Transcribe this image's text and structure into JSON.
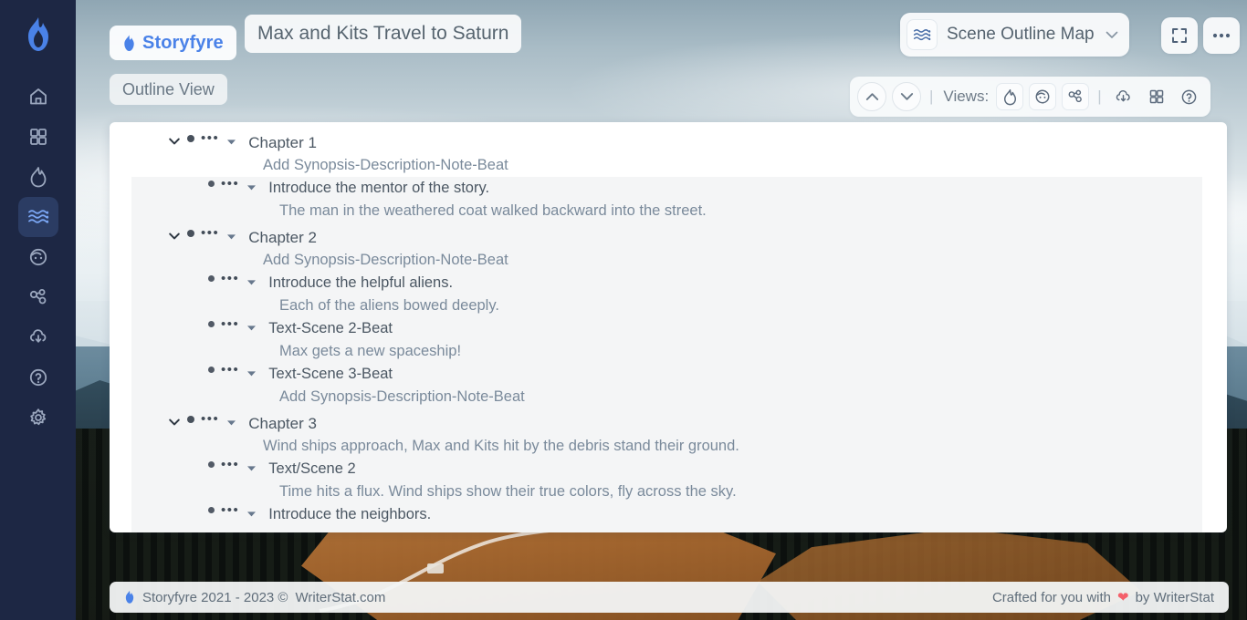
{
  "brand": {
    "name": "Storyfyre",
    "logo_icon": "flame-icon",
    "accent_color": "#4a82e8"
  },
  "document": {
    "title": "Max and Kits Travel to Saturn",
    "view_mode": "Outline View"
  },
  "sidebar": {
    "items": [
      {
        "icon": "home-icon",
        "name": "home"
      },
      {
        "icon": "grid-icon",
        "name": "dashboard"
      },
      {
        "icon": "flame-icon",
        "name": "story"
      },
      {
        "icon": "waves-icon",
        "name": "scene-outline-map",
        "active": true
      },
      {
        "icon": "face-icon",
        "name": "characters"
      },
      {
        "icon": "molecule-icon",
        "name": "relations"
      },
      {
        "icon": "cloud-download-icon",
        "name": "export"
      },
      {
        "icon": "help-circle-icon",
        "name": "help"
      },
      {
        "icon": "gear-icon",
        "name": "settings"
      }
    ]
  },
  "toolbar": {
    "map_select_label": "Scene Outline Map",
    "map_select_icon": "waves-icon",
    "chevron_icon": "chevron-down-icon",
    "fullscreen_icon": "fullscreen-icon",
    "more_icon": "ellipsis-icon"
  },
  "views_bar": {
    "up_icon": "chevron-up-icon",
    "down_icon": "chevron-down-icon",
    "separator": "|",
    "label": "Views:",
    "view_icons": [
      "flame-icon",
      "face-icon",
      "molecule-icon"
    ],
    "separator2": "|",
    "action_icons": [
      "cloud-download-icon",
      "grid-icon",
      "help-circle-icon"
    ]
  },
  "outline": {
    "nodes": [
      {
        "title": "Chapter 1",
        "synopsis": "Add Synopsis-Description-Note-Beat",
        "highlighted": true,
        "children": [
          {
            "title": "Introduce the mentor of the story.",
            "synopsis": "The man in the weathered coat walked backward into the street."
          }
        ]
      },
      {
        "title": "Chapter 2",
        "synopsis": "Add Synopsis-Description-Note-Beat",
        "highlighted": false,
        "children": [
          {
            "title": "Introduce the helpful aliens.",
            "synopsis": "Each of the aliens bowed deeply."
          },
          {
            "title": "Text-Scene 2-Beat",
            "synopsis": "Max gets a new spaceship!"
          },
          {
            "title": "Text-Scene 3-Beat",
            "synopsis": "Add Synopsis-Description-Note-Beat"
          }
        ]
      },
      {
        "title": "Chapter 3",
        "synopsis": "Wind ships approach, Max and Kits hit by the debris stand their ground.",
        "highlighted": false,
        "children": [
          {
            "title": "Text/Scene 2",
            "synopsis": "Time hits a flux. Wind ships show their true colors, fly across the sky."
          },
          {
            "title": "Introduce the neighbors.",
            "synopsis": ""
          }
        ]
      }
    ]
  },
  "footer": {
    "copyright": "Storyfyre 2021 - 2023 ©",
    "site": "WriterStat.com",
    "credit_prefix": "Crafted for you with",
    "heart_icon": "heart-icon",
    "credit_suffix": "by WriterStat"
  }
}
